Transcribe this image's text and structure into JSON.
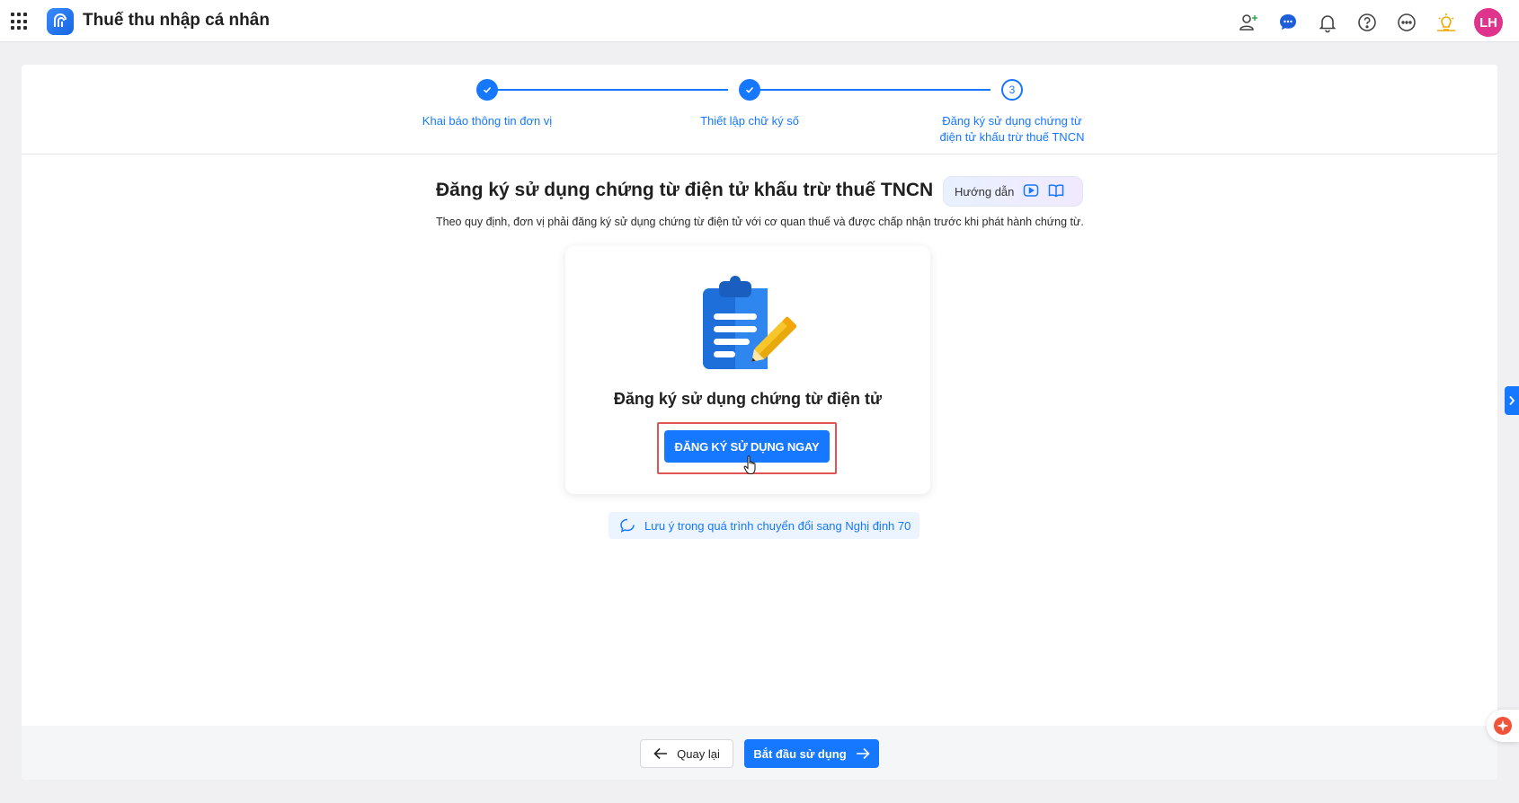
{
  "header": {
    "app_title": "Thuế thu nhập cá nhân",
    "avatar_initials": "LH",
    "icons": [
      "apps-grid-icon",
      "app-logo-icon",
      "add-user-icon",
      "chat-icon",
      "bell-icon",
      "help-icon",
      "more-icon",
      "idea-icon"
    ]
  },
  "stepper": {
    "steps": [
      {
        "label": "Khai báo thông tin đơn vị",
        "status": "done"
      },
      {
        "label": "Thiết lập chữ ký số",
        "status": "done"
      },
      {
        "label_line1": "Đăng ký sử dụng chứng từ",
        "label_line2": "điện tử khấu trừ thuế TNCN",
        "number": "3",
        "status": "current"
      }
    ]
  },
  "content": {
    "title": "Đăng ký sử dụng chứng từ điện tử khấu trừ thuế TNCN",
    "guide_label": "Hướng dẫn",
    "description": "Theo quy định, đơn vị phải đăng ký sử dụng chứng từ điện tử với cơ quan thuế và được chấp nhận trước khi phát hành chứng từ.",
    "register_heading": "Đăng ký sử dụng chứng từ điện tử",
    "register_button": "ĐĂNG KÝ SỬ DỤNG NGAY",
    "note_link": "Lưu ý trong quá trình chuyển đổi sang Nghị định 70"
  },
  "footer": {
    "back_label": "Quay lại",
    "start_label": "Bắt đầu sử dụng"
  },
  "colors": {
    "primary": "#1677ff",
    "highlight": "#e05454",
    "avatar": "#e0338c"
  }
}
